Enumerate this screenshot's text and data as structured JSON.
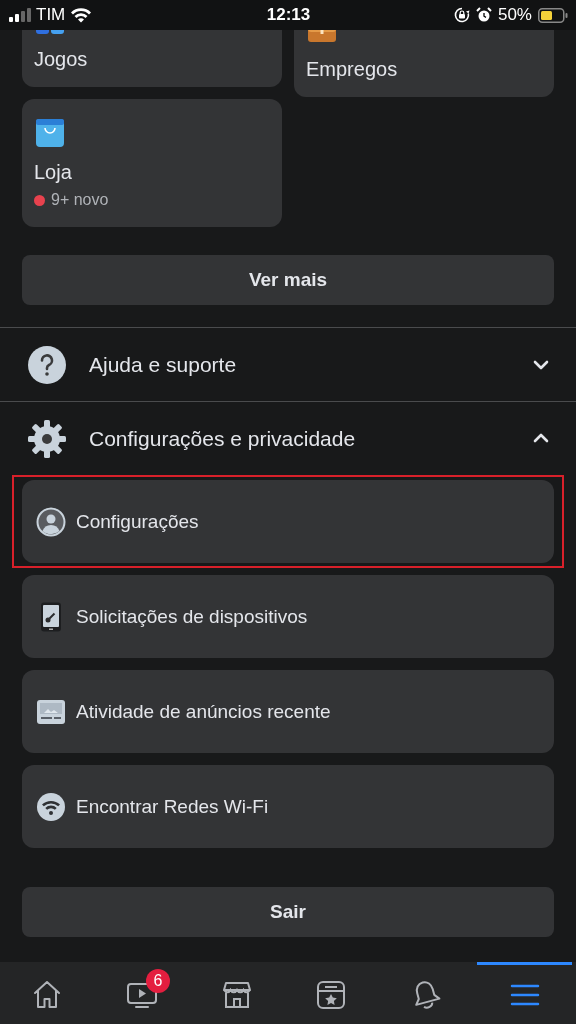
{
  "status_bar": {
    "carrier": "TIM",
    "time": "12:13",
    "battery": "50%"
  },
  "shortcuts": [
    {
      "kind": "games",
      "label": "Jogos"
    },
    {
      "kind": "jobs",
      "label": "Empregos"
    },
    {
      "kind": "shop",
      "label": "Loja",
      "badge": "9+ novo"
    }
  ],
  "see_more": "Ver mais",
  "sections": [
    {
      "kind": "help",
      "title": "Ajuda e suporte",
      "expanded": false
    },
    {
      "kind": "settings",
      "title": "Configurações e privacidade",
      "expanded": true,
      "items": [
        {
          "kind": "profile",
          "label": "Configurações",
          "highlighted": true
        },
        {
          "kind": "device",
          "label": "Solicitações de dispositivos",
          "highlighted": false
        },
        {
          "kind": "ads",
          "label": "Atividade de anúncios recente",
          "highlighted": false
        },
        {
          "kind": "wifi",
          "label": "Encontrar Redes Wi-Fi",
          "highlighted": false
        }
      ]
    }
  ],
  "logout": "Sair",
  "tab_bar": [
    {
      "kind": "home",
      "selected": false
    },
    {
      "kind": "video",
      "selected": false,
      "badge": "6"
    },
    {
      "kind": "marketplace",
      "selected": false
    },
    {
      "kind": "feeds",
      "selected": false
    },
    {
      "kind": "notifications",
      "selected": false
    },
    {
      "kind": "menu",
      "selected": true
    }
  ]
}
